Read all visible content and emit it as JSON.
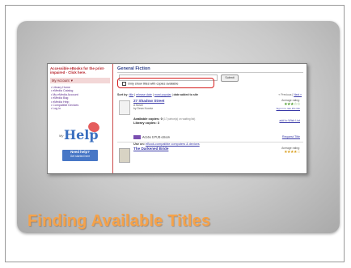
{
  "slide": {
    "title": "Finding Available Titles"
  },
  "screenshot": {
    "sidebar": {
      "banner": "Accessible eBooks for the print-impaired - Click here.",
      "account": "My Account ▼",
      "menu": [
        "• Library Home",
        "• eMedia Catalog",
        "• My eMedia Account",
        "• eMedia Bag",
        "• eMedia Help",
        "• Compatible Devices",
        "• Log in"
      ],
      "help": {
        "my": "My",
        "word": "Help",
        "need_help": "Need help?",
        "sub": "Get started here"
      }
    },
    "main": {
      "title": "General Fiction",
      "search_button": "Submit",
      "filter_label": "Only show titles with copies available",
      "sort": {
        "prefix": "Sort by:",
        "options": [
          "title",
          "release date",
          "most popular",
          "date added to site"
        ]
      },
      "pager": {
        "prev": "« Previous |",
        "next": "Next »"
      },
      "items": [
        {
          "title": "27 Shadow Street",
          "subtitle": "A Novel",
          "author": "by Dean Koontz",
          "rating_label": "Average rating:",
          "stars": "★★★☆☆",
          "sign_in": "Sign in to rate this title",
          "available": "Available copies: 0",
          "waiting": "(17 patron(s) on waiting list)",
          "library_copies": "Library copies: 3",
          "wish": "add to Wish List",
          "format": "Adobe EPUB eBook",
          "request": "Request Title",
          "use_on_prefix": "Use on:",
          "use_on_link": "eBook-compatible computers & devices"
        },
        {
          "title": "The Darkened Bride",
          "rating_label": "Average rating:",
          "stars": "★★★★☆"
        }
      ]
    }
  },
  "colors": {
    "title_orange": "#f5a24a",
    "highlight_red": "#d61d1d",
    "link_blue": "#3a3aa8"
  }
}
